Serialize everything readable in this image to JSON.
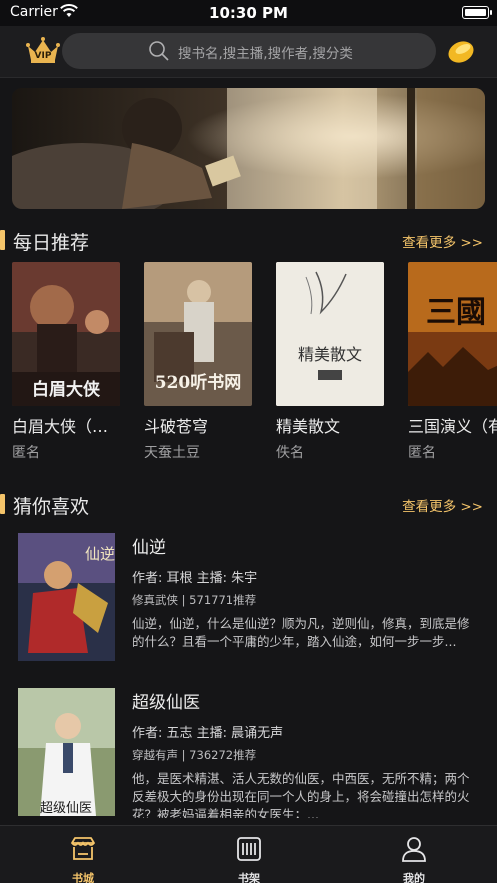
{
  "status_bar": {
    "carrier": "Carrier",
    "time": "10:30 PM"
  },
  "header": {
    "vip_label": "VIP",
    "search_placeholder": "搜书名,搜主播,搜作者,搜分类"
  },
  "daily": {
    "title": "每日推荐",
    "see_more": "查看更多 >>",
    "books": [
      {
        "title": "白眉大侠（有声）",
        "author": "匿名",
        "cover_text": "白眉大侠"
      },
      {
        "title": "斗破苍穹",
        "author": "天蚕土豆",
        "cover_text": "520听书网"
      },
      {
        "title": "精美散文",
        "author": "佚名",
        "cover_text": "精美散文"
      },
      {
        "title": "三国演义（有声）",
        "author": "匿名",
        "cover_text": "三國"
      }
    ]
  },
  "guess": {
    "title": "猜你喜欢",
    "see_more": "查看更多 >>",
    "items": [
      {
        "title": "仙逆",
        "author_line": "作者: 耳根  主播: 朱宇",
        "genre_line": "修真武侠 | 571771推荐",
        "desc": "仙逆，仙逆，什么是仙逆？顺为凡，逆则仙，修真，到底是修的什么？且看一个平庸的少年，踏入仙途，如何一步一步...",
        "cover_text": "仙逆"
      },
      {
        "title": "超级仙医",
        "author_line": "作者: 五志  主播: 晨诵无声",
        "genre_line": "穿越有声 | 736272推荐",
        "desc": "他，是医术精湛、活人无数的仙医，中西医，无所不精；两个反差极大的身份出现在同一个人的身上，将会碰撞出怎样的火花？被老妈逼着相亲的女医生；...",
        "cover_text": "超级仙医"
      }
    ]
  },
  "tabs": [
    {
      "label": "书城",
      "icon": "store-icon",
      "active": true
    },
    {
      "label": "书架",
      "icon": "bookshelf-icon",
      "active": false
    },
    {
      "label": "我的",
      "icon": "profile-icon",
      "active": false
    }
  ],
  "colors": {
    "accent": "#f4c46a",
    "background": "#151517",
    "header": "#1d1d1f"
  }
}
